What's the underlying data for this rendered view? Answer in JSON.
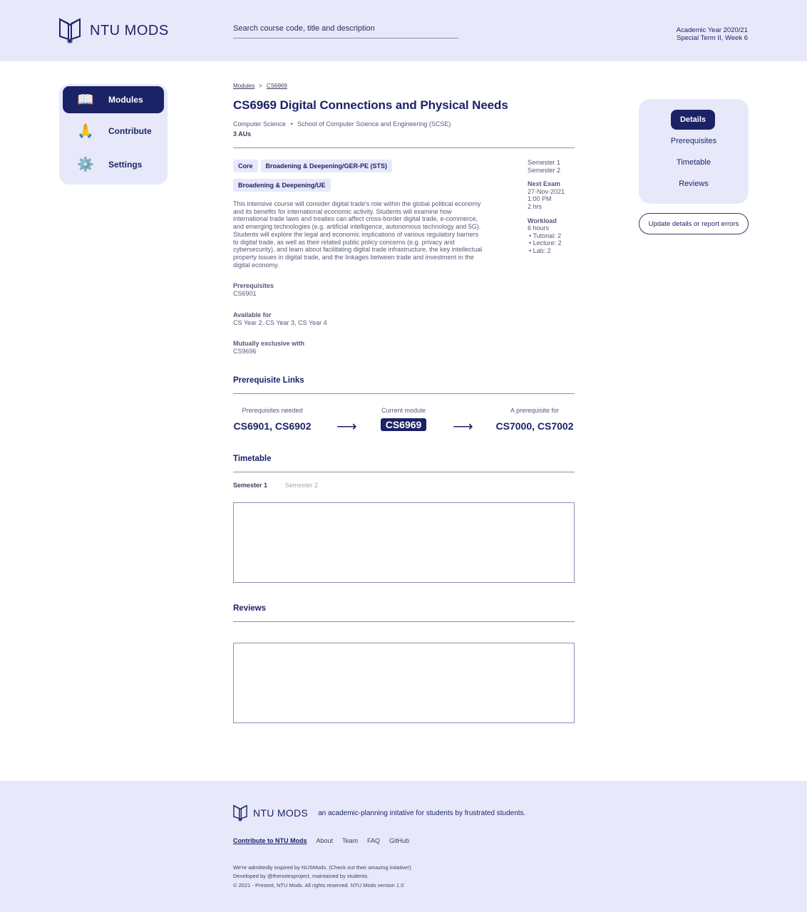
{
  "header": {
    "brand": "NTU MODS",
    "search_placeholder": "Search course code, title and description",
    "academic_year": "Academic Year 2020/21",
    "term_week": "Special Term II, Week 6"
  },
  "sidebar": {
    "items": [
      {
        "label": "Modules",
        "icon": "book-icon",
        "active": true
      },
      {
        "label": "Contribute",
        "icon": "folded-hands-icon",
        "active": false
      },
      {
        "label": "Settings",
        "icon": "gear-icon",
        "active": false
      }
    ]
  },
  "breadcrumb": {
    "root": "Modules",
    "sep": ">",
    "current": "CS6969"
  },
  "module": {
    "title": "CS6969 Digital Connections and Physical Needs",
    "department": "Computer Science",
    "dot": "•",
    "faculty": "School of Computer Science and Engineering (SCSE)",
    "aus": "3 AUs",
    "tags": [
      "Core",
      "Broadening & Deepening/GER-PE (STS)",
      "Broadening & Deepening/UE"
    ],
    "description": "This intensive course will consider digital trade's role within the global political economy and its benefits for international economic activity. Students will examine how international trade laws and treaties can affect cross-border digital trade, e-commerce, and emerging technologies (e.g. artificial intelligence, autonomous technology and 5G). Students will explore the legal and economic implications of various regulatory barriers to digital trade, as well as their related public policy concerns (e.g. privacy and cybersecurity), and learn about facilitating digital trade infrastructure, the key intellectual property issues in digital trade, and the linkages between trade and investment in the digital economy.",
    "prerequisites_label": "Prerequisites",
    "prerequisites": "CS6901",
    "available_label": "Available for",
    "available": "CS Year 2, CS Year 3, CS Year 4",
    "mutex_label": "Mutually exclusive with",
    "mutex": "CS9696",
    "semesters": [
      "Semester 1",
      "Semester 2"
    ],
    "exam_label": "Next Exam",
    "exam_date": "27-Nov-2021",
    "exam_time": "1:00 PM",
    "exam_duration": "2 hrs",
    "workload_label": "Workload",
    "workload_total": "6 hours",
    "workload_items": [
      "• Tutorial: 2",
      "• Lecture: 2",
      "• Lab: 2"
    ]
  },
  "prereq_links": {
    "title": "Prerequisite Links",
    "needed_caption": "Prerequisites needed",
    "needed": "CS6901, CS6902",
    "current_caption": "Current module",
    "current": "CS6969",
    "for_caption": "A prerequisite for",
    "for": "CS7000, CS7002",
    "arrow": "⟶"
  },
  "timetable": {
    "title": "Timetable",
    "tabs": [
      "Semester 1",
      "Semester 2"
    ]
  },
  "reviews": {
    "title": "Reviews"
  },
  "rightnav": {
    "items": [
      "Details",
      "Prerequisites",
      "Timetable",
      "Reviews"
    ],
    "report": "Update details or report errors"
  },
  "footer": {
    "brand": "NTU MODS",
    "tagline": "an academic-planning initative for students by frustrated students.",
    "links": [
      "Contribute to NTU Mods",
      "About",
      "Team",
      "FAQ",
      "GitHub"
    ],
    "notes": [
      "We're admittedly inspired by NUSMods. (Check out their amazing initative!)",
      "Developed by @thenotesproject, maintained by students.",
      "© 2021 - Present, NTU Mods. All rights reserved. NTU Mods version 1.0"
    ]
  },
  "colors": {
    "navy": "#1c2266",
    "lavender": "#e7e9fb"
  }
}
